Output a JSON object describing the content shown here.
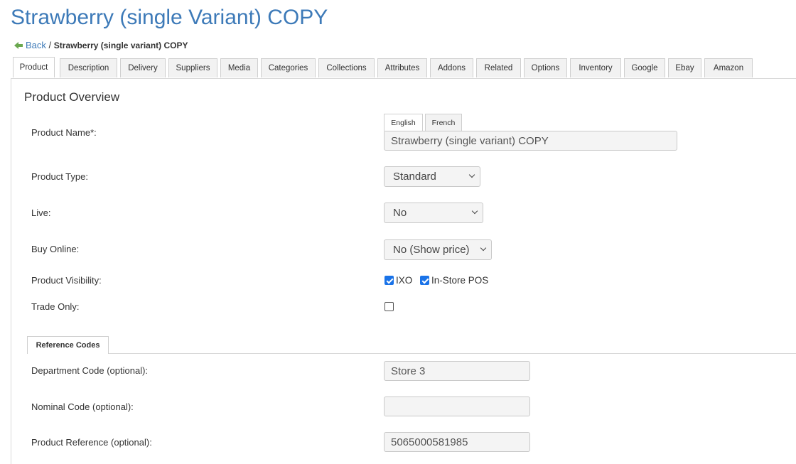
{
  "page": {
    "title": "Strawberry (single Variant) COPY"
  },
  "breadcrumb": {
    "back": "Back",
    "separator": "/",
    "current": "Strawberry (single variant) COPY"
  },
  "tabs": [
    "Product",
    "Description",
    "Delivery",
    "Suppliers",
    "Media",
    "Categories",
    "Collections",
    "Attributes",
    "Addons",
    "Related",
    "Options",
    "Inventory",
    "Google",
    "Ebay",
    "Amazon"
  ],
  "active_tab": "Product",
  "overview": {
    "title": "Product Overview",
    "language_tabs": [
      "English",
      "French"
    ],
    "active_language": "English",
    "fields": {
      "product_name": {
        "label": "Product Name*:",
        "value": "Strawberry (single variant) COPY"
      },
      "product_type": {
        "label": "Product Type:",
        "value": "Standard"
      },
      "live": {
        "label": "Live:",
        "value": "No"
      },
      "buy_online": {
        "label": "Buy Online:",
        "value": "No (Show price)"
      },
      "visibility": {
        "label": "Product Visibility:",
        "options": [
          {
            "label": "IXO",
            "checked": true
          },
          {
            "label": "In-Store POS",
            "checked": true
          }
        ]
      },
      "trade_only": {
        "label": "Trade Only:",
        "checked": false
      }
    }
  },
  "reference_codes": {
    "tab": "Reference Codes",
    "fields": {
      "department_code": {
        "label": "Department Code (optional):",
        "value": "Store 3"
      },
      "nominal_code": {
        "label": "Nominal Code (optional):",
        "value": ""
      },
      "product_reference": {
        "label": "Product Reference (optional):",
        "value": "5065000581985"
      }
    }
  },
  "colors": {
    "title": "#3d7ab8",
    "back_arrow": "#6aa84f",
    "checkbox": "#1a73e8"
  }
}
